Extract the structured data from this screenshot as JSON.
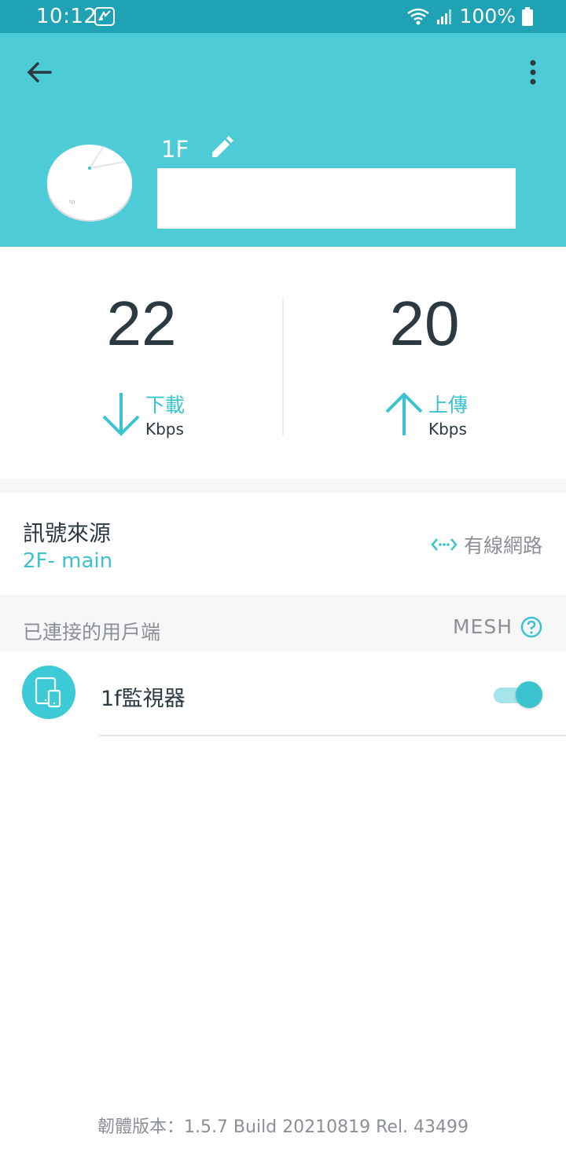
{
  "status_bar": {
    "time": "10:12",
    "battery": "100%",
    "background": "#1fa3b4"
  },
  "header": {
    "device_name": "1F",
    "background": "#4dcbd7",
    "icons": [
      "back-arrow-icon",
      "more-vert-icon",
      "edit-pencil-icon"
    ]
  },
  "speed": {
    "download": {
      "value": "22",
      "label": "下載",
      "unit": "Kbps"
    },
    "upload": {
      "value": "20",
      "label": "上傳",
      "unit": "Kbps"
    }
  },
  "signal": {
    "title": "訊號來源",
    "source": "2F- main",
    "connection_type": "有線網路"
  },
  "clients": {
    "title": "已連接的用戶端",
    "mesh_label": "MESH",
    "items": [
      {
        "name": "1f監視器",
        "enabled": true
      }
    ]
  },
  "firmware": "韌體版本：1.5.7 Build 20210819 Rel. 43499",
  "colors": {
    "accent": "#3cc3d0",
    "text_dark": "#2b3940",
    "text_gray": "#8a9096"
  }
}
